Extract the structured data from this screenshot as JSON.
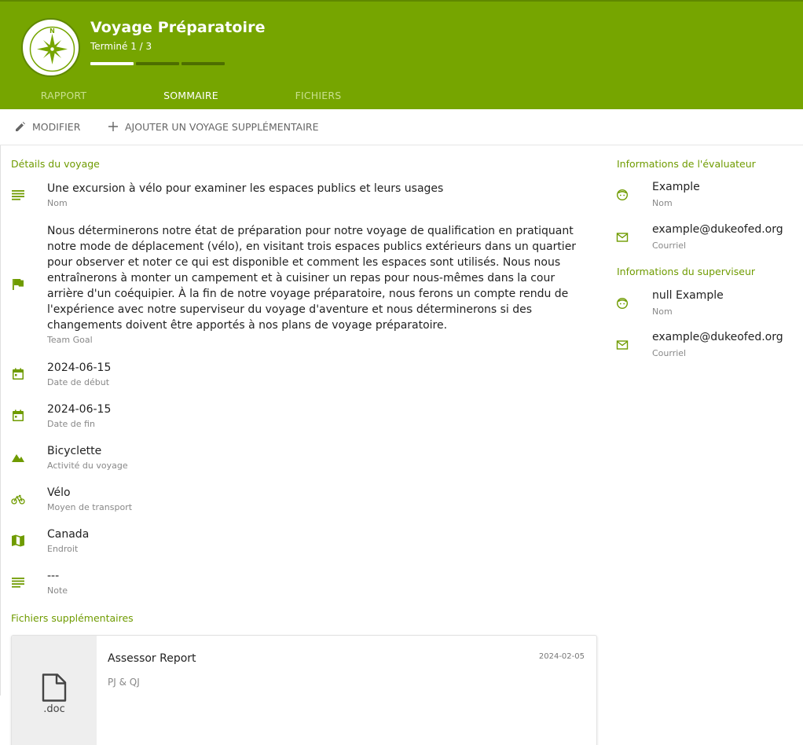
{
  "header": {
    "title": "Voyage Préparatoire",
    "subtitle": "Terminé 1 / 3",
    "progress": {
      "completed": 1,
      "total": 3
    },
    "badge_letter": "N",
    "color": "#76a500"
  },
  "tabs": [
    {
      "label": "RAPPORT",
      "active": false
    },
    {
      "label": "SOMMAIRE",
      "active": true
    },
    {
      "label": "FICHIERS",
      "active": false
    }
  ],
  "toolbar": {
    "edit_label": "MODIFIER",
    "add_label": "AJOUTER UN VOYAGE SUPPLÉMENTAIRE"
  },
  "details": {
    "title": "Détails du voyage",
    "items": [
      {
        "icon": "notes-icon",
        "value": "Une excursion à vélo pour examiner les espaces publics et leurs usages",
        "label": "Nom"
      },
      {
        "icon": "flag-icon",
        "value": "Nous déterminerons notre état de préparation pour notre voyage de qualification en pratiquant notre mode de déplacement (vélo), en visitant trois espaces publics extérieurs dans un quartier pour observer et noter ce qui est disponible et comment les espaces sont utilisés. Nous nous entraînerons à monter un campement et à cuisiner un repas pour nous-mêmes dans la cour arrière d'un coéquipier. À la fin de notre voyage préparatoire, nous ferons un compte rendu de l'expérience avec notre superviseur du voyage d'aventure et nous déterminerons si des changements doivent être apportés à nos plans de voyage préparatoire.",
        "label": "Team Goal"
      },
      {
        "icon": "calendar-icon",
        "value": "2024-06-15",
        "label": "Date de début"
      },
      {
        "icon": "calendar-icon",
        "value": "2024-06-15",
        "label": "Date de fin"
      },
      {
        "icon": "mountain-icon",
        "value": "Bicyclette",
        "label": "Activité du voyage"
      },
      {
        "icon": "bicycle-icon",
        "value": "Vélo",
        "label": "Moyen de transport"
      },
      {
        "icon": "map-icon",
        "value": "Canada",
        "label": "Endroit"
      },
      {
        "icon": "notes-icon",
        "value": "---",
        "label": "Note"
      }
    ]
  },
  "assessor": {
    "title": "Informations de l'évaluateur",
    "name": "Example",
    "name_label": "Nom",
    "email": "example@dukeofed.org",
    "email_label": "Courriel"
  },
  "supervisor": {
    "title": "Informations du superviseur",
    "name": "null Example",
    "name_label": "Nom",
    "email": "example@dukeofed.org",
    "email_label": "Courriel"
  },
  "files": {
    "title": "Fichiers supplémentaires",
    "items": [
      {
        "name": "Assessor Report",
        "description": "PJ & QJ",
        "date": "2024-02-05",
        "ext": ".doc"
      }
    ]
  }
}
